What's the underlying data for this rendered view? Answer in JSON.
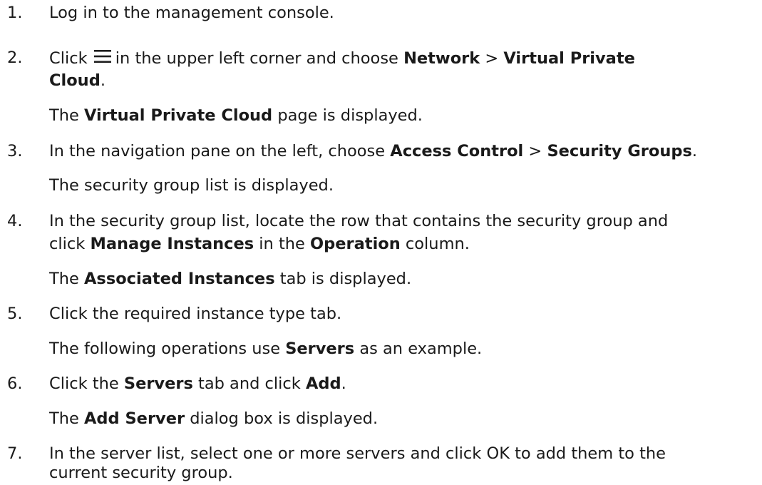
{
  "steps": [
    {
      "num": "1.",
      "a": "Log in to the management console."
    },
    {
      "num": "2.",
      "a": "Click",
      "b": "in the upper left corner and choose",
      "c": "Network",
      "d": ">",
      "e": "Virtual Private",
      "f": "Cloud",
      "g": "."
    },
    {
      "num": "",
      "a": "The",
      "b": "Virtual Private Cloud",
      "c": "page is displayed."
    },
    {
      "num": "3.",
      "a": "In the navigation pane on the left, choose",
      "b": "Access Control",
      "c": ">",
      "d": "Security Groups",
      "e": "."
    },
    {
      "num": "",
      "a": "The security group list is displayed."
    },
    {
      "num": "4.",
      "a": "In the security group list, locate the row that contains the security group and",
      "b": "click",
      "c": "Manage Instances",
      "d": "in the",
      "e": "Operation",
      "f": "column."
    },
    {
      "num": "",
      "a": "The",
      "b": "Associated Instances",
      "c": "tab is displayed."
    },
    {
      "num": "5.",
      "a": "Click the required instance type tab."
    },
    {
      "num": "",
      "a": "The following operations use",
      "b": "Servers",
      "c": "as an example."
    },
    {
      "num": "6.",
      "a": "Click the",
      "b": "Servers",
      "c": "tab and click",
      "d": "Add",
      "e": "."
    },
    {
      "num": "",
      "a": "The",
      "b": "Add Server",
      "c": "dialog box is displayed."
    },
    {
      "num": "7.",
      "a": "In the server list, select one or more servers and click OK to add them to the",
      "b": "current security group."
    }
  ]
}
